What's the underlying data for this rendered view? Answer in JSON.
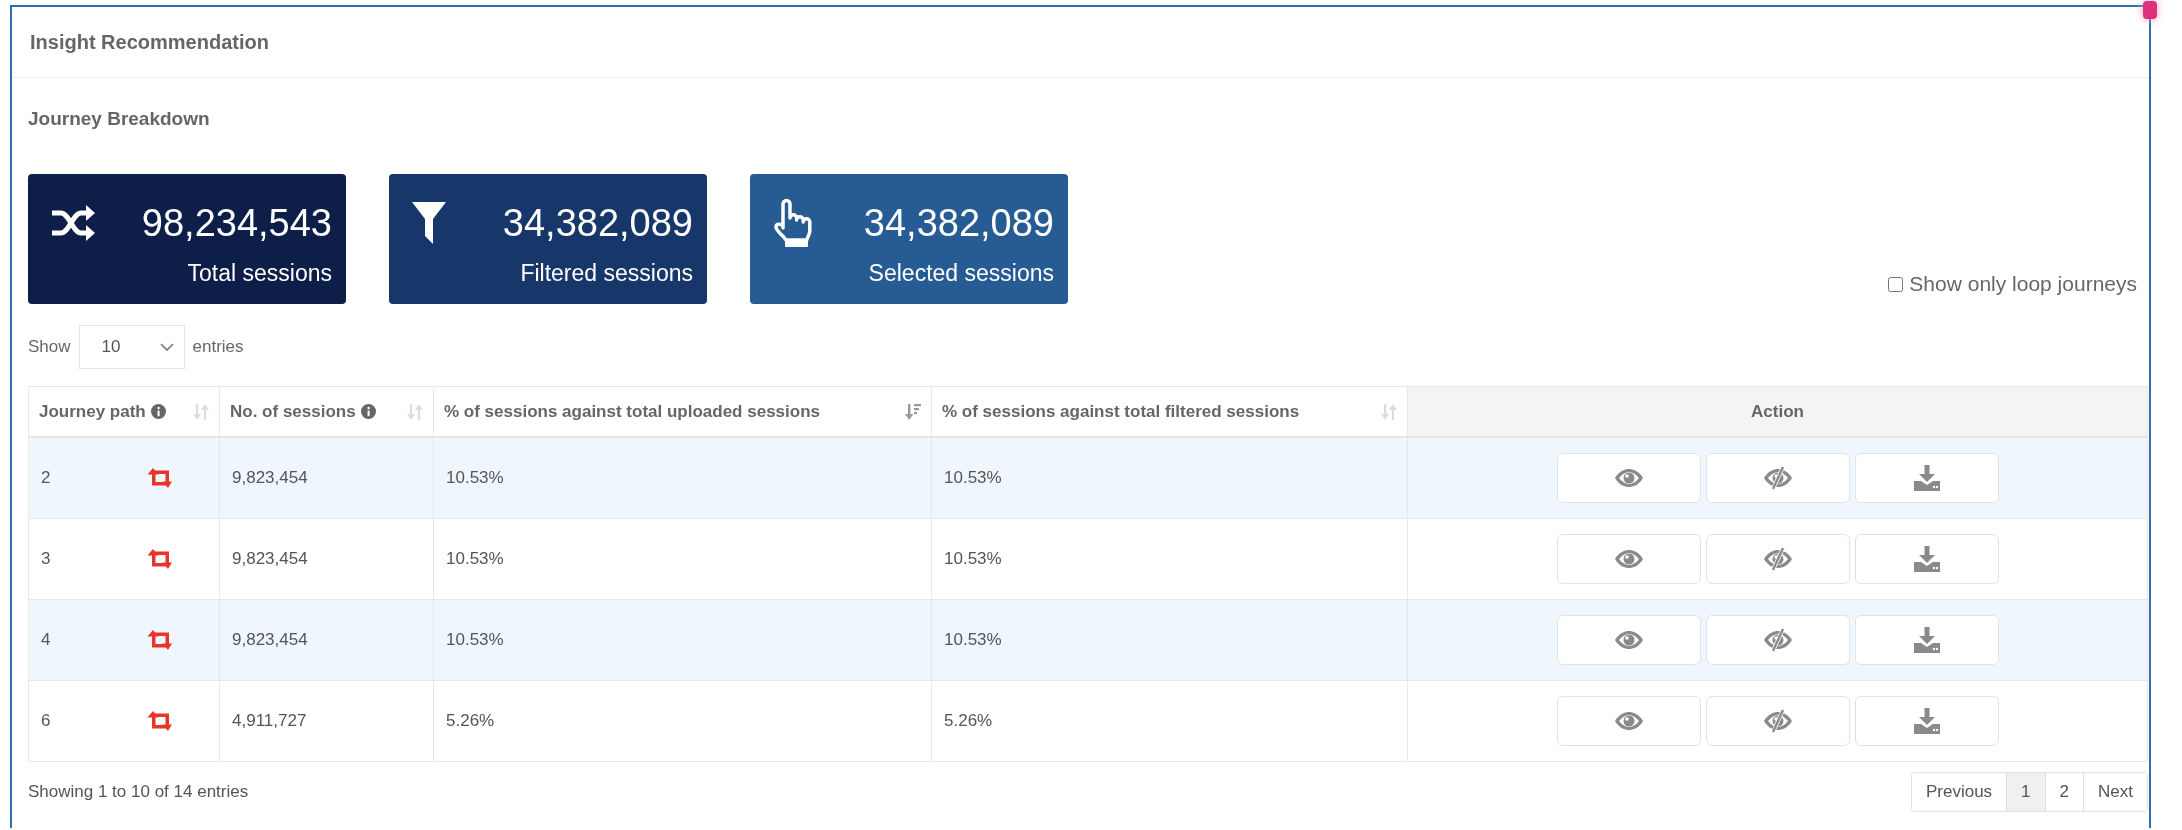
{
  "panel": {
    "title": "Insight Recommendation"
  },
  "section_title": "Journey Breakdown",
  "stats": [
    {
      "kind": "total",
      "color": "#0d1e48",
      "value": "98,234,543",
      "label": "Total sessions"
    },
    {
      "kind": "filtered",
      "color": "#17366a",
      "value": "34,382,089",
      "label": "Filtered sessions"
    },
    {
      "kind": "selected",
      "color": "#265b94",
      "value": "34,382,089",
      "label": "Selected sessions"
    }
  ],
  "loop_filter": {
    "label": "Show only loop journeys",
    "checked": false
  },
  "page_length": {
    "before": "Show",
    "value": "10",
    "after": "entries"
  },
  "table": {
    "columns": [
      {
        "label": "Journey path",
        "kind": "sortable",
        "info": true,
        "sorted": false
      },
      {
        "label": "No. of sessions",
        "kind": "sortable",
        "info": true,
        "sorted": false
      },
      {
        "label": "% of sessions against total uploaded sessions",
        "kind": "sortable",
        "info": false,
        "sorted": true
      },
      {
        "label": "% of sessions against total filtered sessions",
        "kind": "sortable",
        "info": false,
        "sorted": false
      },
      {
        "label": "Action",
        "kind": "action"
      }
    ],
    "rows": [
      {
        "journey_path": "2",
        "loop": true,
        "sessions": "9,823,454",
        "pct_uploaded": "10.53%",
        "pct_filtered": "10.53%"
      },
      {
        "journey_path": "3",
        "loop": true,
        "sessions": "9,823,454",
        "pct_uploaded": "10.53%",
        "pct_filtered": "10.53%"
      },
      {
        "journey_path": "4",
        "loop": true,
        "sessions": "9,823,454",
        "pct_uploaded": "10.53%",
        "pct_filtered": "10.53%"
      },
      {
        "journey_path": "6",
        "loop": true,
        "sessions": "4,911,727",
        "pct_uploaded": "5.26%",
        "pct_filtered": "5.26%"
      }
    ]
  },
  "info": "Showing 1 to 10 of 14 entries",
  "pagination": {
    "previous": "Previous",
    "pages": [
      {
        "label": "1",
        "selected": true
      },
      {
        "label": "2",
        "selected": false
      }
    ],
    "next": "Next"
  }
}
